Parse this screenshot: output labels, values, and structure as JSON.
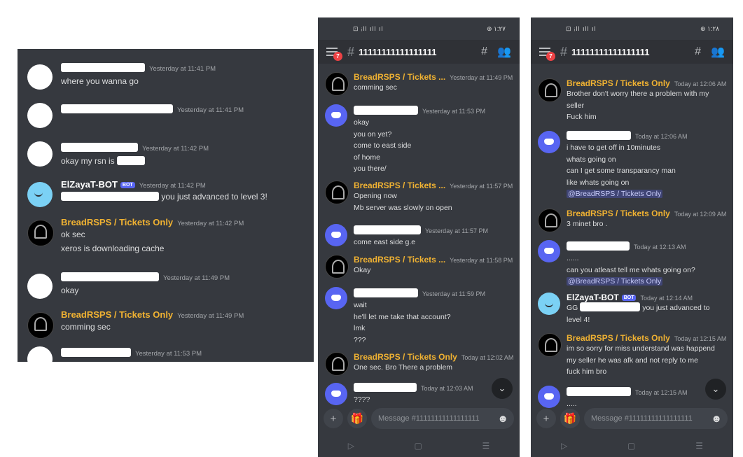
{
  "left": {
    "messages": [
      {
        "time": "Yesterday at 11:41 PM",
        "lines": [
          "where you wanna go"
        ]
      },
      {
        "time": "Yesterday at 11:41 PM",
        "lines": []
      },
      {
        "time": "Yesterday at 11:42 PM",
        "lines": [
          "okay my rsn is"
        ]
      },
      {
        "author": "ElZayaT-BOT",
        "badge": "BOT",
        "time": "Yesterday at 11:42 PM",
        "lines": [
          "you just advanced to level 3!"
        ]
      },
      {
        "author": "BreadRSPS / Tickets Only",
        "time": "Yesterday at 11:42 PM",
        "lines": [
          "ok sec",
          "xeros is downloading cache"
        ]
      },
      {
        "time": "Yesterday at 11:49 PM",
        "lines": [
          "okay"
        ]
      },
      {
        "author": "BreadRSPS / Tickets Only",
        "time": "Yesterday at 11:49 PM",
        "lines": [
          "comming sec"
        ]
      },
      {
        "time": "Yesterday at 11:53 PM",
        "lines": []
      }
    ]
  },
  "mid": {
    "status": {
      "left": "⊡ ᵢll ıll ıl",
      "right": "⊕ ١:٢٧"
    },
    "channel": "11111111111111111",
    "unread": "7",
    "messages": [
      {
        "author": "BreadRSPS / Tickets ...",
        "time": "Yesterday at 11:49 PM",
        "lines": [
          "comming sec"
        ]
      },
      {
        "time": "Yesterday at 11:53 PM",
        "lines": [
          "okay",
          "you on yet?",
          "come to east side",
          "of home",
          "you there/"
        ]
      },
      {
        "author": "BreadRSPS / Tickets ...",
        "time": "Yesterday at 11:57 PM",
        "lines": [
          "Opening now",
          "Mb server was slowly on open"
        ]
      },
      {
        "time": "Yesterday at 11:57 PM",
        "lines": [
          "come east side g.e"
        ]
      },
      {
        "author": "BreadRSPS / Tickets ...",
        "time": "Yesterday at 11:58 PM",
        "lines": [
          "Okay"
        ]
      },
      {
        "time": "Yesterday at 11:59 PM",
        "lines": [
          "wait",
          "he'll let me take that account?",
          "lmk",
          "???"
        ]
      },
      {
        "author": "BreadRSPS / Tickets Only",
        "time": "Today at 12:02 AM",
        "lines": [
          "One sec. Bro There a problem"
        ]
      },
      {
        "time": "Today at 12:03 AM",
        "lines": [
          "????"
        ]
      }
    ],
    "placeholder": "Message #11111111111111111"
  },
  "right": {
    "status": {
      "left": "⊡ ᵢll ıll ıl",
      "right": "⊕ ١:٢٨"
    },
    "channel": "11111111111111111",
    "unread": "7",
    "messages": [
      {
        "author": "BreadRSPS / Tickets Only",
        "time": "Today at 12:06 AM",
        "lines": [
          "Brother don't worry there a problem with my",
          "seller",
          "Fuck him"
        ]
      },
      {
        "time": "Today at 12:06 AM",
        "lines": [
          "i have to get off in 10minutes",
          "whats going on",
          "can I get some transparancy man",
          "like whats going on"
        ],
        "mention": "@BreadRSPS / Tickets Only"
      },
      {
        "author": "BreadRSPS / Tickets Only",
        "time": "Today at 12:09 AM",
        "lines": [
          "3 minet bro ."
        ]
      },
      {
        "time": "Today at 12:13 AM",
        "lines": [
          "......",
          "can you atleast tell me whats going on?"
        ],
        "mention": "@BreadRSPS / Tickets Only"
      },
      {
        "author": "ElZayaT-BOT",
        "badge": "BOT",
        "time": "Today at 12:14 AM",
        "lines": [
          "GG",
          "level 4!"
        ],
        "tail": "you just advanced to"
      },
      {
        "author": "BreadRSPS / Tickets Only",
        "time": "Today at 12:15 AM",
        "lines": [
          "im so sorry for miss understand was happend",
          "my seller he was afk and not reply to me",
          "fuck him bro"
        ]
      },
      {
        "time": "Today at 12:15 AM",
        "lines": [
          "....."
        ]
      }
    ],
    "placeholder": "Message #11111111111111111"
  },
  "icons": {
    "menu": "menu-icon",
    "threads": "threads-icon",
    "members": "members-icon",
    "add": "plus-icon",
    "gift": "gift-icon",
    "emoji": "emoji-icon",
    "down": "chevron-down-icon"
  },
  "colors": {
    "background": "#36393f",
    "author": "#f0b232",
    "mention": "#c9cdfb",
    "blurple": "#5865f2"
  }
}
